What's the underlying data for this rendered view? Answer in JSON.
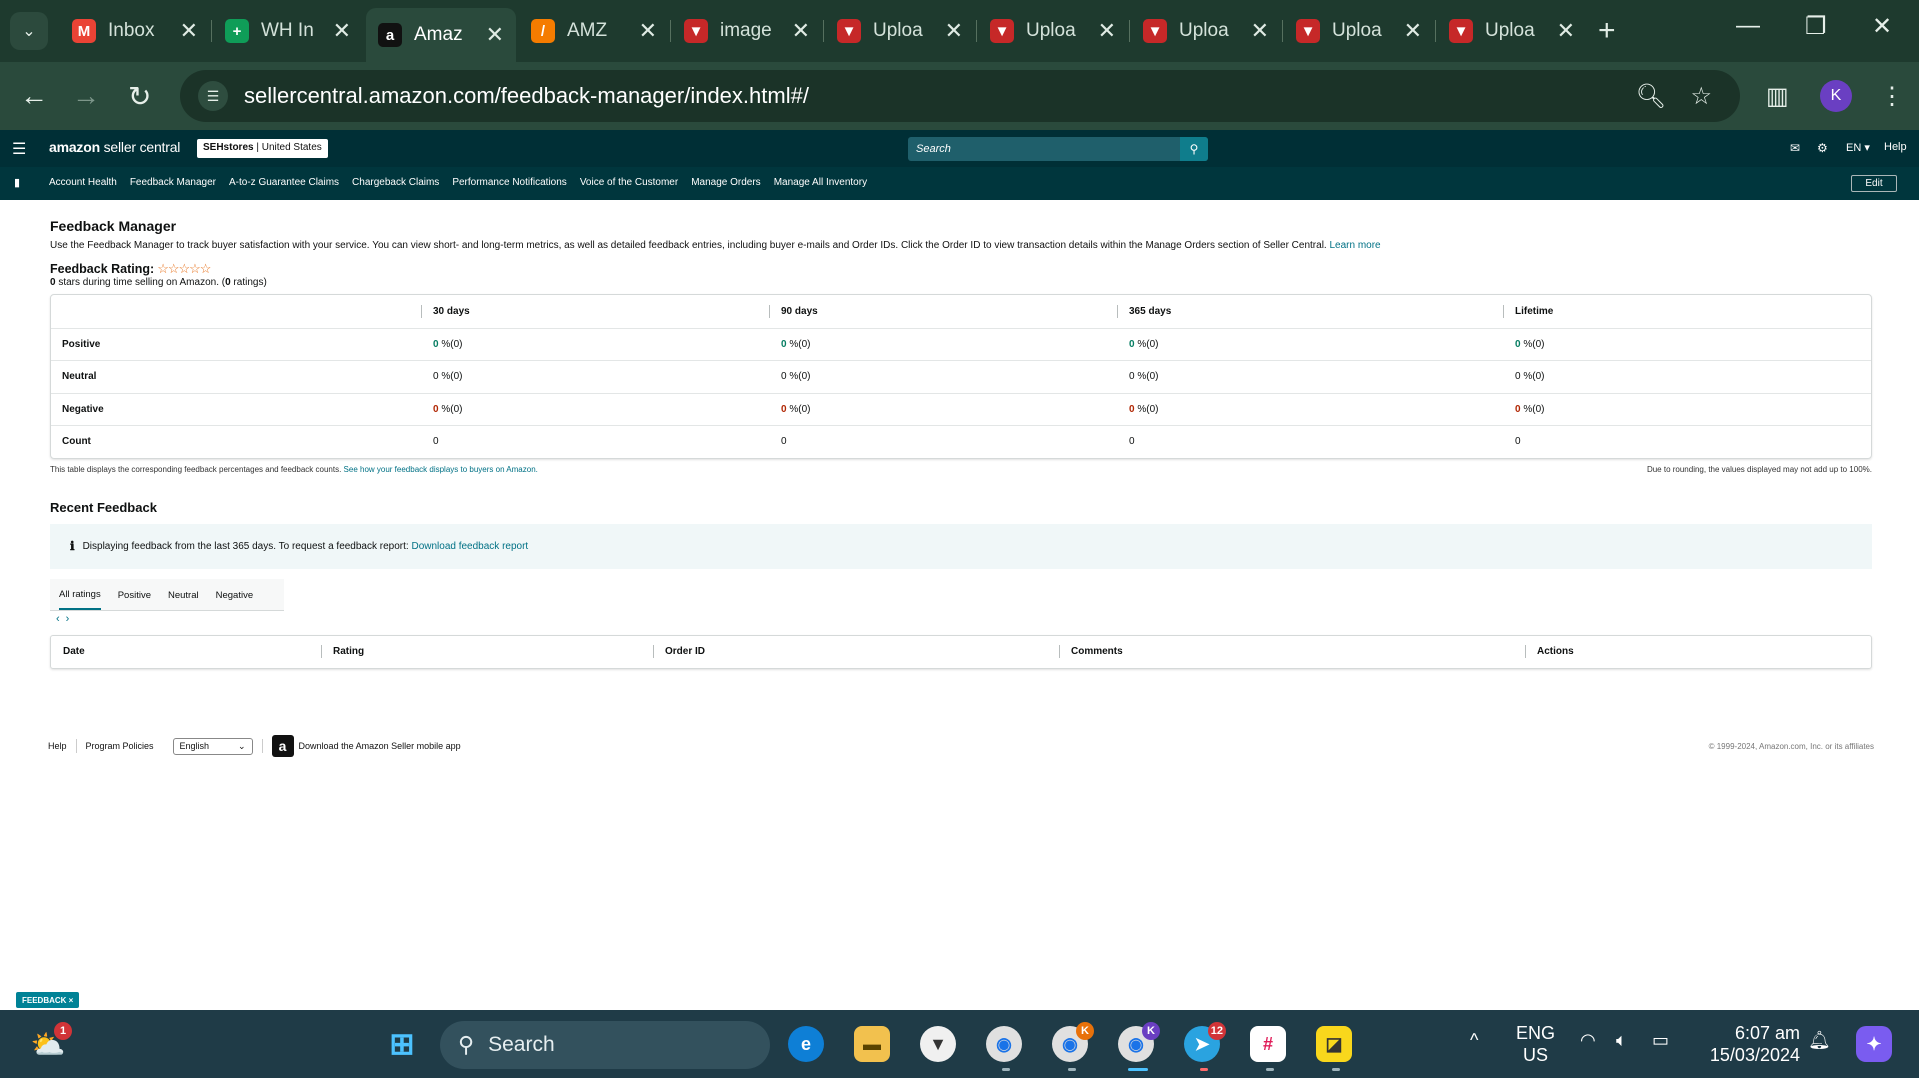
{
  "browser": {
    "tabs": [
      {
        "title": "Inbox",
        "icon": "gmail-icon",
        "color": "#ea4335",
        "glyph": "M"
      },
      {
        "title": "WH In",
        "icon": "sheets-icon",
        "color": "#0f9d58",
        "glyph": "+"
      },
      {
        "title": "Amaz",
        "icon": "amazon-icon",
        "color": "#111111",
        "glyph": "a"
      },
      {
        "title": "AMZ",
        "icon": "app-icon",
        "color": "#f57c00",
        "glyph": "/"
      },
      {
        "title": "image",
        "icon": "upload-site-icon",
        "color": "#c62828",
        "glyph": "▼"
      },
      {
        "title": "Uploa",
        "icon": "upload-site-icon",
        "color": "#c62828",
        "glyph": "▼"
      },
      {
        "title": "Uploa",
        "icon": "upload-site-icon",
        "color": "#c62828",
        "glyph": "▼"
      },
      {
        "title": "Uploa",
        "icon": "upload-site-icon",
        "color": "#c62828",
        "glyph": "▼"
      },
      {
        "title": "Uploa",
        "icon": "upload-site-icon",
        "color": "#c62828",
        "glyph": "▼"
      },
      {
        "title": "Uploa",
        "icon": "upload-site-icon",
        "color": "#c62828",
        "glyph": "▼"
      }
    ],
    "url": "sellercentral.amazon.com/feedback-manager/index.html#/",
    "profile_initial": "K"
  },
  "header": {
    "logo_bold": "amazon",
    "logo_rest": " seller central",
    "store_name": "SEHstores",
    "store_region": "United States",
    "search_placeholder": "Search",
    "lang": "EN ▾",
    "help": "Help"
  },
  "nav": {
    "items": [
      "Account Health",
      "Feedback Manager",
      "A-to-z Guarantee Claims",
      "Chargeback Claims",
      "Performance Notifications",
      "Voice of the Customer",
      "Manage Orders",
      "Manage All Inventory"
    ],
    "edit": "Edit"
  },
  "page": {
    "title": "Feedback Manager",
    "intro": "Use the Feedback Manager to track buyer satisfaction with your service. You can view short- and long-term metrics, as well as detailed feedback entries, including buyer e-mails and Order IDs. Click the Order ID to view transaction details within the Manage Orders section of Seller Central.",
    "learn_more": "Learn more",
    "rating_label": "Feedback Rating:",
    "stars": "☆☆☆☆☆",
    "rating_value": "0",
    "rating_text_a": " stars during time selling on Amazon. (",
    "rating_count": "0",
    "rating_text_b": " ratings)"
  },
  "feedback_table": {
    "columns": [
      "30 days",
      "90 days",
      "365 days",
      "Lifetime"
    ],
    "rows": [
      {
        "label": "Positive",
        "tone": "g",
        "cells": [
          [
            "0",
            " %(0)"
          ],
          [
            "0",
            " %(0)"
          ],
          [
            "0",
            " %(0)"
          ],
          [
            "0",
            " %(0)"
          ]
        ]
      },
      {
        "label": "Neutral",
        "tone": "",
        "cells": [
          [
            "0",
            " %(0)"
          ],
          [
            "0",
            " %(0)"
          ],
          [
            "0",
            " %(0)"
          ],
          [
            "0",
            " %(0)"
          ]
        ]
      },
      {
        "label": "Negative",
        "tone": "r",
        "cells": [
          [
            "0",
            " %(0)"
          ],
          [
            "0",
            " %(0)"
          ],
          [
            "0",
            " %(0)"
          ],
          [
            "0",
            " %(0)"
          ]
        ]
      },
      {
        "label": "Count",
        "tone": "",
        "cells": [
          [
            "",
            "0"
          ],
          [
            "",
            "0"
          ],
          [
            "",
            "0"
          ],
          [
            "",
            "0"
          ]
        ]
      }
    ],
    "note_left": "This table displays the corresponding feedback percentages and feedback counts.",
    "note_link": "See how your feedback displays to buyers on Amazon.",
    "note_right": "Due to rounding, the values displayed may not add up to 100%."
  },
  "recent": {
    "title": "Recent Feedback",
    "info_text": "Displaying feedback from the last 365 days. To request a feedback report:",
    "info_link": "Download feedback report",
    "tabs": [
      "All ratings",
      "Positive",
      "Neutral",
      "Negative"
    ],
    "columns": [
      "Date",
      "Rating",
      "Order ID",
      "Comments",
      "Actions"
    ]
  },
  "footer": {
    "help": "Help",
    "policies": "Program Policies",
    "language": "English",
    "app": "Download the Amazon Seller mobile app",
    "copyright": "© 1999-2024, Amazon.com, Inc. or its affiliates"
  },
  "feedback_badge": "FEEDBACK ×",
  "taskbar": {
    "search": "Search",
    "lang_top": "ENG",
    "lang_bottom": "US",
    "time": "6:07 am",
    "date": "15/03/2024",
    "weather_badge": "1",
    "chrome_badge_k1": "K",
    "chrome_badge_k2": "K",
    "telegram_badge": "12"
  }
}
